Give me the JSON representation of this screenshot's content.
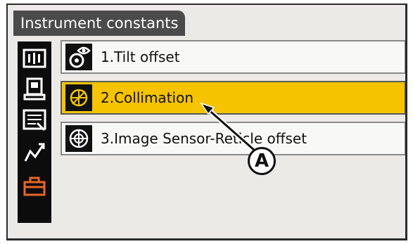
{
  "window": {
    "title": "Instrument constants"
  },
  "sidebar": {
    "icons": [
      {
        "name": "tilt-level-icon",
        "active": false
      },
      {
        "name": "instrument-icon",
        "active": false
      },
      {
        "name": "config-list-icon",
        "active": false
      },
      {
        "name": "graph-icon",
        "active": false
      },
      {
        "name": "toolbox-icon",
        "active": true
      }
    ]
  },
  "menu": {
    "items": [
      {
        "label": "1.Tilt offset",
        "icon": "tilt-offset-icon",
        "selected": false
      },
      {
        "label": "2.Collimation",
        "icon": "collimation-icon",
        "selected": true
      },
      {
        "label": "3.Image Sensor-Reticle offset",
        "icon": "image-sensor-icon",
        "selected": false
      }
    ]
  },
  "callout": {
    "label": "A"
  },
  "colors": {
    "selected": "#f5c300",
    "title_tab": "#4b4b4b",
    "sidebar": "#0c0c0c",
    "active_icon": "#e8662a"
  }
}
